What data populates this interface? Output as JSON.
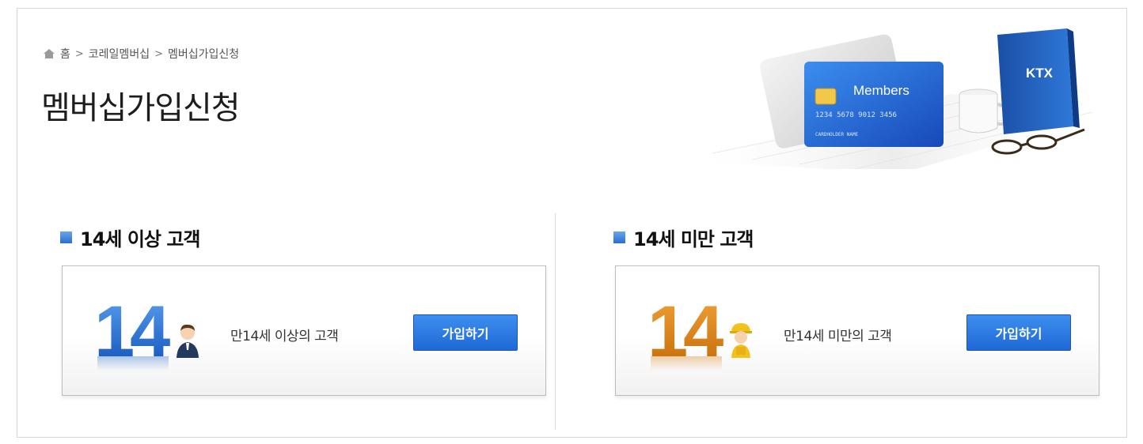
{
  "breadcrumb": {
    "home_icon": "home-icon",
    "items": [
      "홈",
      "코레일멤버십",
      "멤버십가입신청"
    ],
    "separator": ">"
  },
  "page_title": "멤버십가입신청",
  "hero": {
    "card_label": "Members",
    "card_number": "1234  5678  9012  3456",
    "card_holder": "CARDHOLDER  NAME",
    "book_label": "KTX"
  },
  "sections": [
    {
      "title": "14세 이상 고객",
      "badge_number": "14",
      "badge_color": "#1a63c9",
      "figure_icon": "adult-person-icon",
      "description": "만14세 이상의 고객",
      "button_label": "가입하기"
    },
    {
      "title": "14세 미만 고객",
      "badge_number": "14",
      "badge_color": "#d67a0c",
      "figure_icon": "child-person-icon",
      "description": "만14세 미만의 고객",
      "button_label": "가입하기"
    }
  ],
  "colors": {
    "accent_blue": "#2a6fd0",
    "accent_orange": "#d67a0c",
    "button_blue": "#1f68d6"
  }
}
